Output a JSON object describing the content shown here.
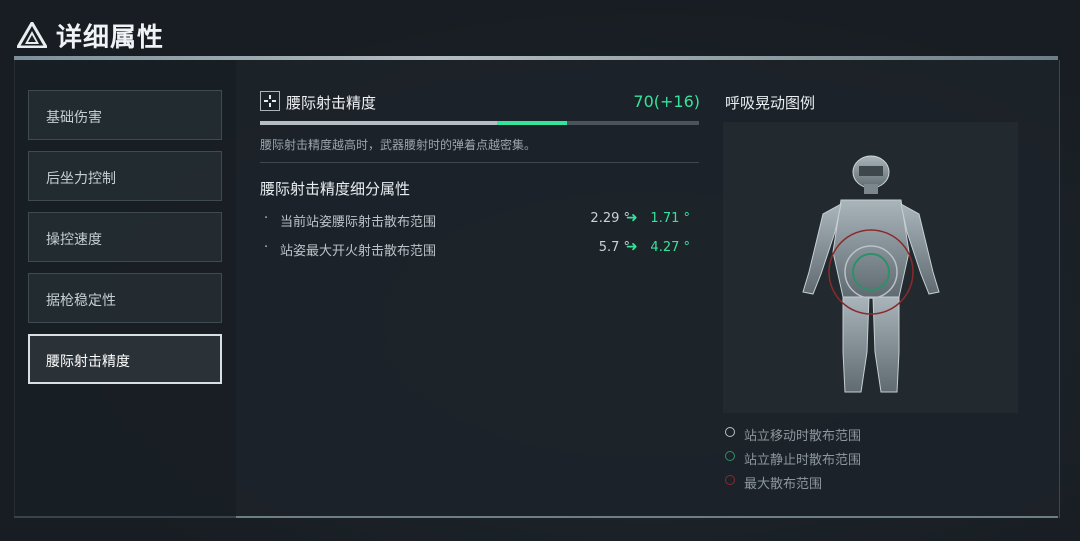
{
  "header": {
    "title": "详细属性",
    "logo_icon": "triangle-logo-icon"
  },
  "sidebar": {
    "items": [
      {
        "label": "基础伤害"
      },
      {
        "label": "后坐力控制"
      },
      {
        "label": "操控速度"
      },
      {
        "label": "据枪稳定性"
      },
      {
        "label": "腰际射击精度",
        "active": true
      }
    ]
  },
  "stat": {
    "icon": "crosshair-icon",
    "name": "腰际射击精度",
    "value": "70(+16)",
    "base": 54,
    "bonus": 16,
    "max": 100,
    "description": "腰际射击精度越高时，武器腰射时的弹着点越密集。",
    "colors": {
      "bonus": "#36e39a",
      "base": "#b4bec3"
    }
  },
  "details": {
    "title": "腰际射击精度细分属性",
    "rows": [
      {
        "bullet": "·",
        "label": "当前站姿腰际射击散布范围",
        "old": "2.29 °",
        "arrow": "➜",
        "new": "1.71 °"
      },
      {
        "bullet": "·",
        "label": "站姿最大开火射击散布范围",
        "old": "5.7 °",
        "arrow": "➜",
        "new": "4.27 °"
      }
    ]
  },
  "breath": {
    "title": "呼吸晃动图例",
    "legend": [
      {
        "label": "站立移动时散布范围",
        "color": "#b8c2c7"
      },
      {
        "label": "站立静止时散布范围",
        "color": "#2f8f6a"
      },
      {
        "label": "最大散布范围",
        "color": "#8a2a2a"
      }
    ]
  }
}
